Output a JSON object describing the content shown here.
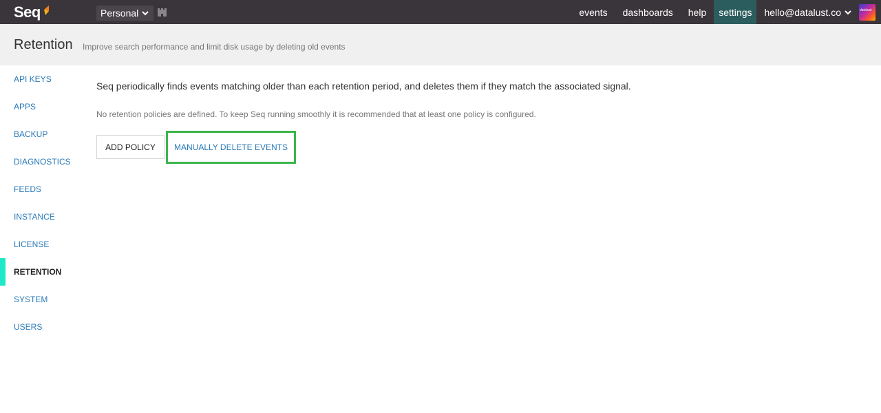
{
  "app": {
    "logo_text": "Seq",
    "logo_icon": "seq-logo-mark-icon",
    "workspace": "Personal",
    "workspace_icon": "castle-icon"
  },
  "nav": {
    "items": [
      {
        "label": "events"
      },
      {
        "label": "dashboards"
      },
      {
        "label": "help"
      },
      {
        "label": "settings",
        "active": true
      }
    ],
    "user": "hello@datalust.co",
    "avatar_icon": "user-avatar-icon",
    "avatar_text": "datalust"
  },
  "header": {
    "title": "Retention",
    "subtitle": "Improve search performance and limit disk usage by deleting old events"
  },
  "sidebar": {
    "items": [
      {
        "label": "API KEYS"
      },
      {
        "label": "APPS"
      },
      {
        "label": "BACKUP"
      },
      {
        "label": "DIAGNOSTICS"
      },
      {
        "label": "FEEDS"
      },
      {
        "label": "INSTANCE"
      },
      {
        "label": "LICENSE"
      },
      {
        "label": "RETENTION",
        "active": true
      },
      {
        "label": "SYSTEM"
      },
      {
        "label": "USERS"
      }
    ]
  },
  "main": {
    "intro": "Seq periodically finds events matching older than each retention period, and deletes them if they match the associated signal.",
    "notice": "No retention policies are defined. To keep Seq running smoothly it is recommended that at least one policy is configured.",
    "add_policy_label": "ADD POLICY",
    "manual_delete_label": "MANUALLY DELETE EVENTS"
  },
  "colors": {
    "topbar": "#3a353a",
    "active_nav": "#2c5d5e",
    "link": "#2a7ab8",
    "active_marker": "#1de9c8",
    "highlight_border": "#3cb44b"
  }
}
